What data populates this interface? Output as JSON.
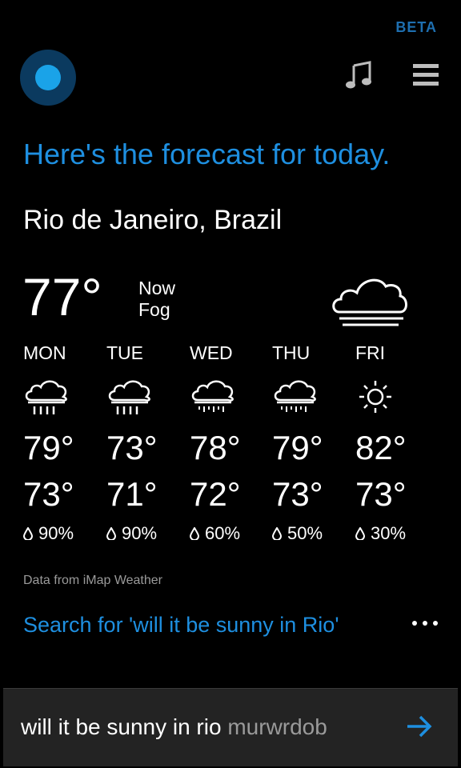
{
  "header": {
    "beta_label": "BETA"
  },
  "response": {
    "headline": "Here's the forecast for today.",
    "location": "Rio de Janeiro, Brazil"
  },
  "current": {
    "temp": "77°",
    "label": "Now",
    "condition": "Fog",
    "icon": "fog-cloud-icon"
  },
  "forecast": [
    {
      "day": "MON",
      "icon": "rain-icon",
      "high": "79°",
      "low": "73°",
      "precip": "90%"
    },
    {
      "day": "TUE",
      "icon": "rain-icon",
      "high": "73°",
      "low": "71°",
      "precip": "90%"
    },
    {
      "day": "WED",
      "icon": "drizzle-icon",
      "high": "78°",
      "low": "72°",
      "precip": "60%"
    },
    {
      "day": "THU",
      "icon": "drizzle-icon",
      "high": "79°",
      "low": "73°",
      "precip": "50%"
    },
    {
      "day": "FRI",
      "icon": "sun-icon",
      "high": "82°",
      "low": "73°",
      "precip": "30%"
    }
  ],
  "source": "Data from iMap Weather",
  "search_link": "Search for 'will it be sunny in Rio'",
  "query": {
    "typed": "will it be sunny in rio",
    "extra": "murwrdob"
  },
  "colors": {
    "accent": "#1e8fe0",
    "background": "#000000",
    "query_bar": "#232323"
  }
}
